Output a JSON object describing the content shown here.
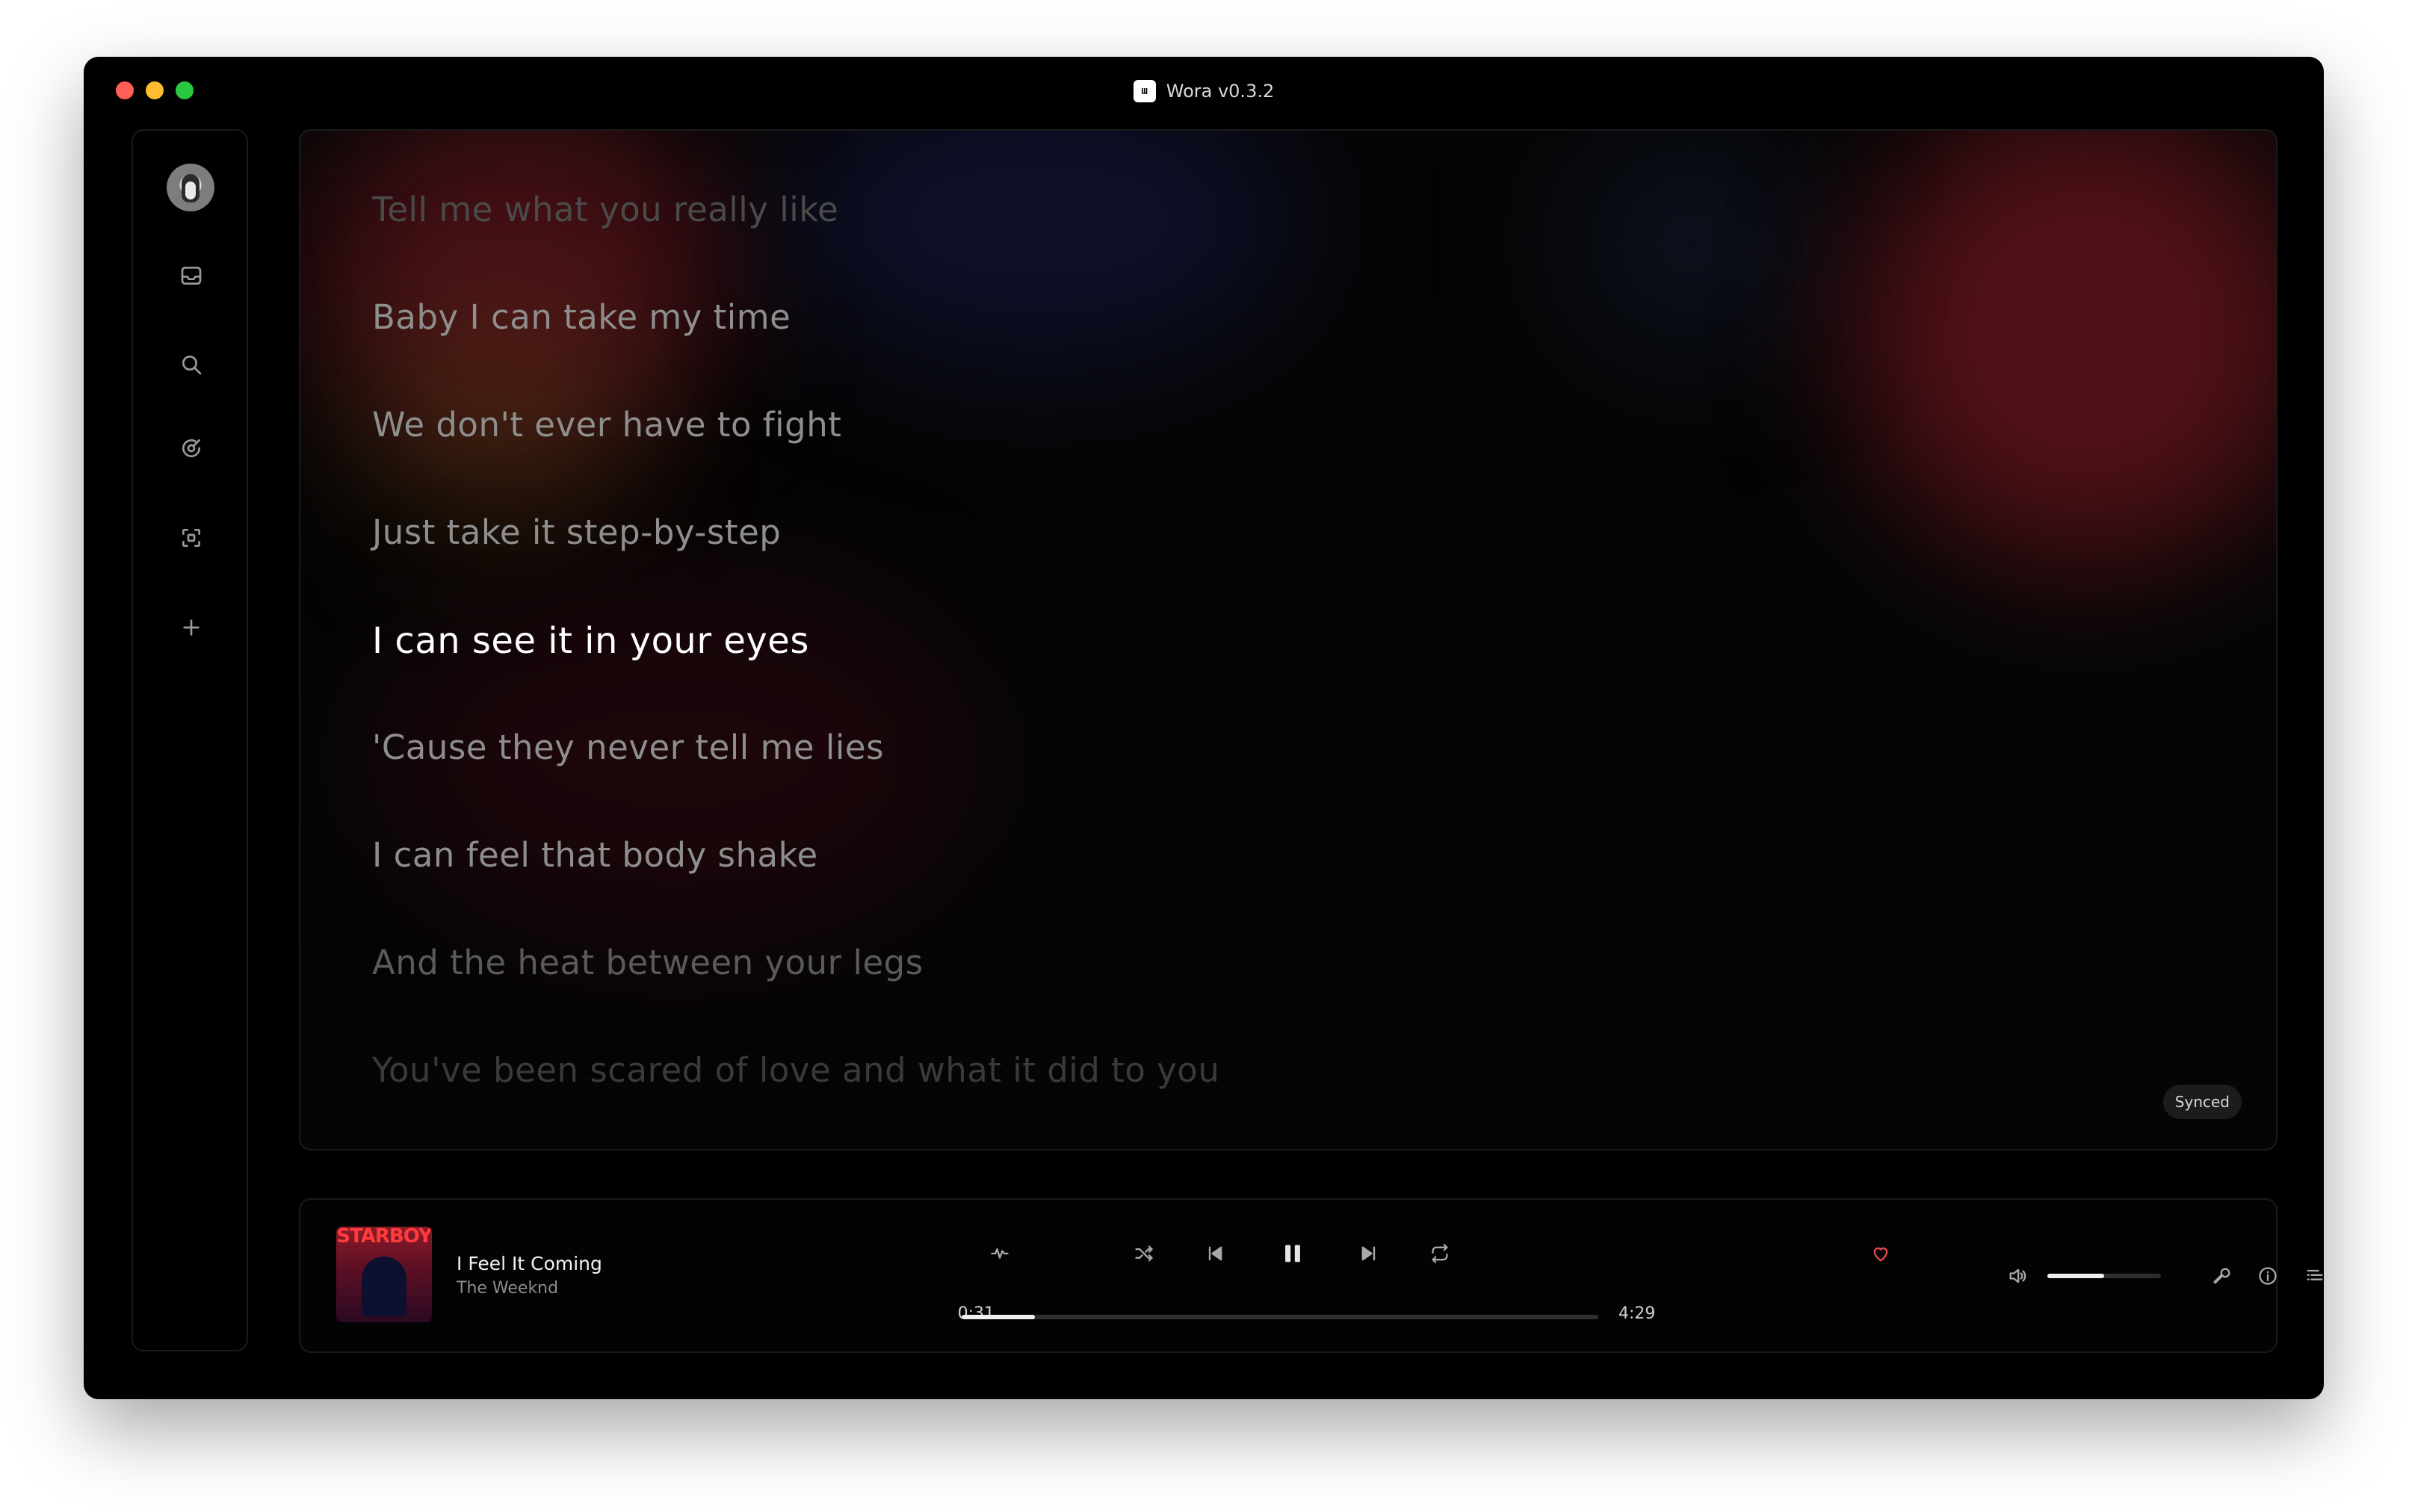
{
  "window": {
    "title": "Wora v0.3.2",
    "logo_text": "ɯ"
  },
  "sidebar": {
    "icons": [
      "avatar",
      "inbox-icon",
      "search-icon",
      "radio-icon",
      "scan-icon",
      "plus-icon"
    ]
  },
  "lyrics": {
    "lines": [
      {
        "text": "Tell me what you really like",
        "state": "faded"
      },
      {
        "text": "Baby I can take my time",
        "state": "dim"
      },
      {
        "text": "We don't ever have to fight",
        "state": "dim"
      },
      {
        "text": "Just take it step-by-step",
        "state": "dim"
      },
      {
        "text": "I can see it in your eyes",
        "state": "active"
      },
      {
        "text": "'Cause they never tell me lies",
        "state": "dim"
      },
      {
        "text": "I can feel that body shake",
        "state": "dim"
      },
      {
        "text": "And the heat between your legs",
        "state": "faded"
      },
      {
        "text": "You've been scared of love and what it did to you",
        "state": "faded"
      }
    ],
    "mode_badge": "Synced"
  },
  "player": {
    "album_label": "STARBOY",
    "track_title": "I Feel It Coming",
    "artist": "The Weeknd",
    "elapsed": "0:31",
    "duration": "4:29",
    "progress_fraction": 0.115,
    "volume_fraction": 0.5,
    "liked": true,
    "colors": {
      "heart": "#e5484d",
      "active_lyric": "#ffffff",
      "dim_lyric": "#8e8e8e",
      "faded_lyric": "#4a4a4a"
    }
  }
}
